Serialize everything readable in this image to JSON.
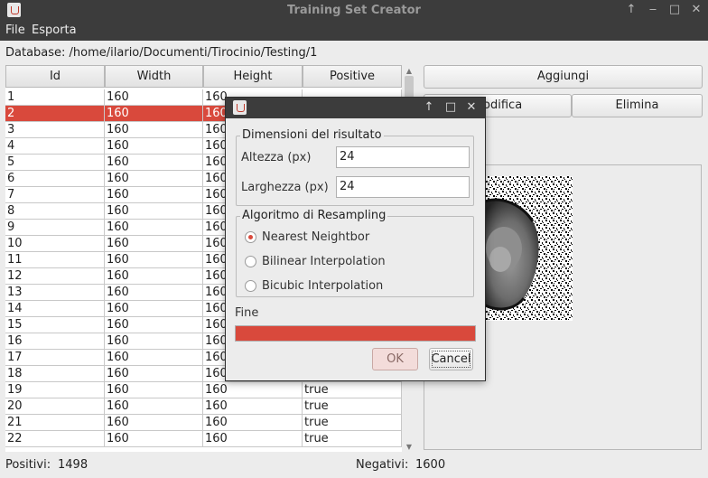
{
  "window": {
    "title": "Training Set Creator",
    "controls": [
      "↑",
      "‒",
      "□",
      "✕"
    ]
  },
  "menu": [
    "File",
    "Esporta"
  ],
  "database_path": "Database: /home/ilario/Documenti/Tirocinio/Testing/1",
  "table": {
    "headers": [
      "Id",
      "Width",
      "Height",
      "Positive"
    ],
    "selected_row": 2,
    "rows": [
      [
        "1",
        "160",
        "160",
        ""
      ],
      [
        "2",
        "160",
        "160",
        ""
      ],
      [
        "3",
        "160",
        "160",
        ""
      ],
      [
        "4",
        "160",
        "160",
        ""
      ],
      [
        "5",
        "160",
        "160",
        ""
      ],
      [
        "6",
        "160",
        "160",
        ""
      ],
      [
        "7",
        "160",
        "160",
        ""
      ],
      [
        "8",
        "160",
        "160",
        ""
      ],
      [
        "9",
        "160",
        "160",
        ""
      ],
      [
        "10",
        "160",
        "160",
        ""
      ],
      [
        "11",
        "160",
        "160",
        ""
      ],
      [
        "12",
        "160",
        "160",
        ""
      ],
      [
        "13",
        "160",
        "160",
        ""
      ],
      [
        "14",
        "160",
        "160",
        ""
      ],
      [
        "15",
        "160",
        "160",
        ""
      ],
      [
        "16",
        "160",
        "160",
        ""
      ],
      [
        "17",
        "160",
        "160",
        ""
      ],
      [
        "18",
        "160",
        "160",
        ""
      ],
      [
        "19",
        "160",
        "160",
        "true"
      ],
      [
        "20",
        "160",
        "160",
        "true"
      ],
      [
        "21",
        "160",
        "160",
        "true"
      ],
      [
        "22",
        "160",
        "160",
        "true"
      ]
    ]
  },
  "buttons": {
    "aggiungi": "Aggiungi",
    "modifica": "Modifica",
    "elimina": "Elimina"
  },
  "status": {
    "positivi_label": "Positivi:",
    "positivi_value": "1498",
    "negativi_label": "Negativi:",
    "negativi_value": "1600"
  },
  "dialog": {
    "controls": [
      "↑",
      "□",
      "✕"
    ],
    "size_group": {
      "title": "Dimensioni del risultato",
      "height_label": "Altezza (px)",
      "height_value": "24",
      "width_label": "Larghezza (px)",
      "width_value": "24"
    },
    "resampling_group": {
      "title": "Algoritmo di Resampling",
      "options": [
        "Nearest Neightbor",
        "Bilinear Interpolation",
        "Bicubic Interpolation"
      ],
      "selected": "Nearest Neightbor"
    },
    "progress_label": "Fine",
    "progress_fraction": 1.0,
    "ok_label": "OK",
    "cancel_label": "Cancel"
  },
  "colors": {
    "accent": "#d9493c",
    "titlebar": "#3c3c3c"
  }
}
